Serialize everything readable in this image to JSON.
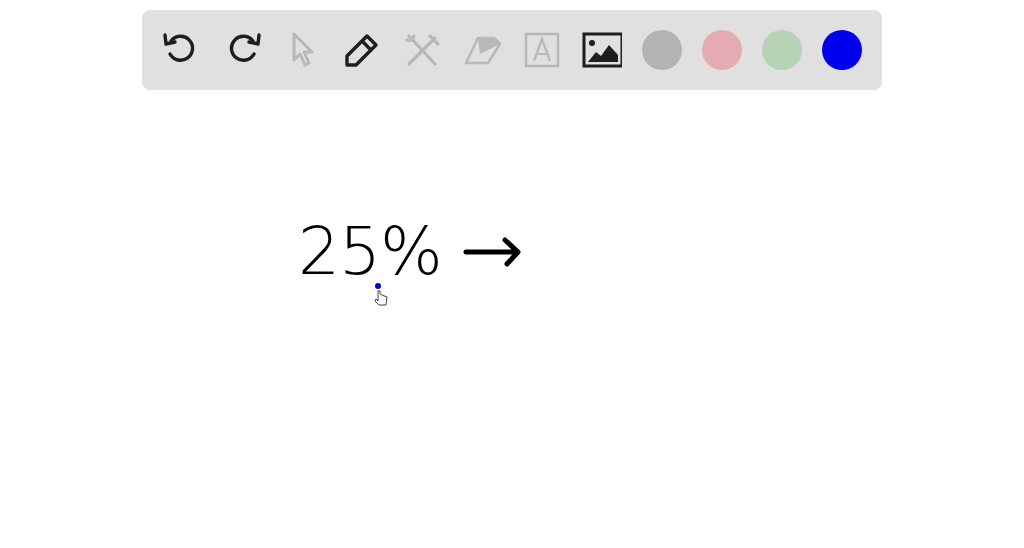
{
  "toolbar": {
    "tools": [
      {
        "kind": "undo",
        "disabled": false
      },
      {
        "kind": "redo",
        "disabled": false
      },
      {
        "kind": "select",
        "disabled": true
      },
      {
        "kind": "pen",
        "disabled": false
      },
      {
        "kind": "tools",
        "disabled": true
      },
      {
        "kind": "eraser",
        "disabled": true
      },
      {
        "kind": "text",
        "disabled": true
      },
      {
        "kind": "image",
        "disabled": false
      }
    ],
    "colors": [
      {
        "color": "#b3b3b3"
      },
      {
        "color": "#e5abb2"
      },
      {
        "color": "#b6d3b5"
      },
      {
        "color": "#0000ee"
      }
    ]
  },
  "canvas": {
    "handwriting": "25%"
  }
}
